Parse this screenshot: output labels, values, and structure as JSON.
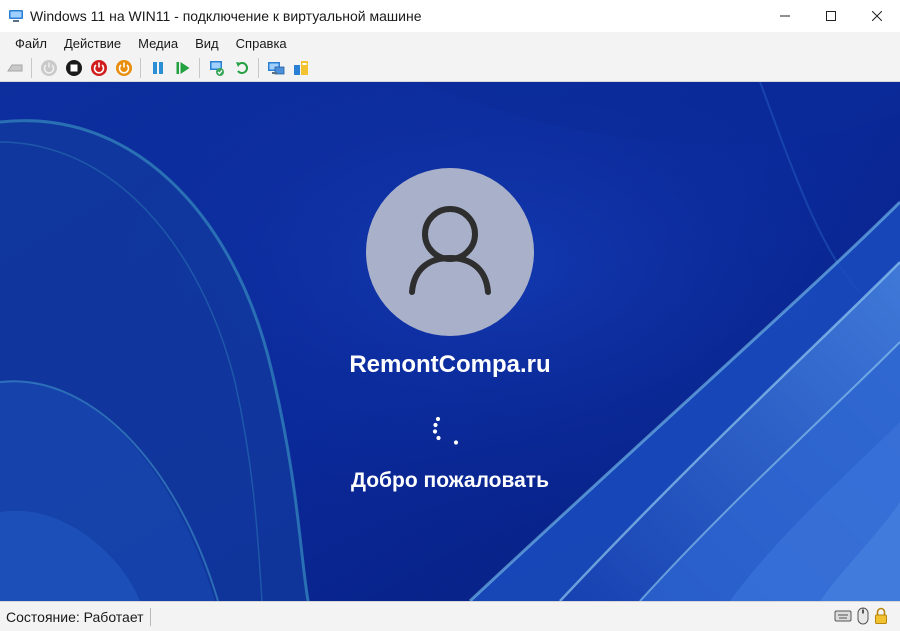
{
  "window": {
    "title": "Windows 11 на WIN11 - подключение к виртуальной машине",
    "icon": "hyper-v-connection-icon",
    "controls": [
      "minimize-icon",
      "maximize-icon",
      "close-icon"
    ]
  },
  "menu": {
    "items": [
      {
        "label": "Файл"
      },
      {
        "label": "Действие"
      },
      {
        "label": "Медиа"
      },
      {
        "label": "Вид"
      },
      {
        "label": "Справка"
      }
    ]
  },
  "toolbar": {
    "buttons": [
      {
        "icon": "ctrl-alt-del-icon"
      },
      {
        "icon": "start-icon"
      },
      {
        "icon": "turn-off-icon"
      },
      {
        "icon": "shut-down-icon"
      },
      {
        "icon": "save-icon"
      },
      {
        "icon": "pause-icon"
      },
      {
        "icon": "resume-icon"
      },
      {
        "icon": "checkpoint-icon"
      },
      {
        "icon": "revert-icon"
      },
      {
        "icon": "enhanced-session-icon"
      },
      {
        "icon": "share-icon"
      }
    ]
  },
  "vm_screen": {
    "user_name": "RemontCompa.ru",
    "welcome_text": "Добро пожаловать",
    "avatar_icon": "user-avatar-icon",
    "spinner_icon": "loading-spinner-icon",
    "colors": {
      "background": "#0a2a9a",
      "avatar_bg": "#a9b0c9",
      "text": "#ffffff"
    }
  },
  "status": {
    "text": "Состояние: Работает",
    "icons": [
      "keyboard-icon",
      "mouse-icon",
      "lock-icon"
    ]
  }
}
